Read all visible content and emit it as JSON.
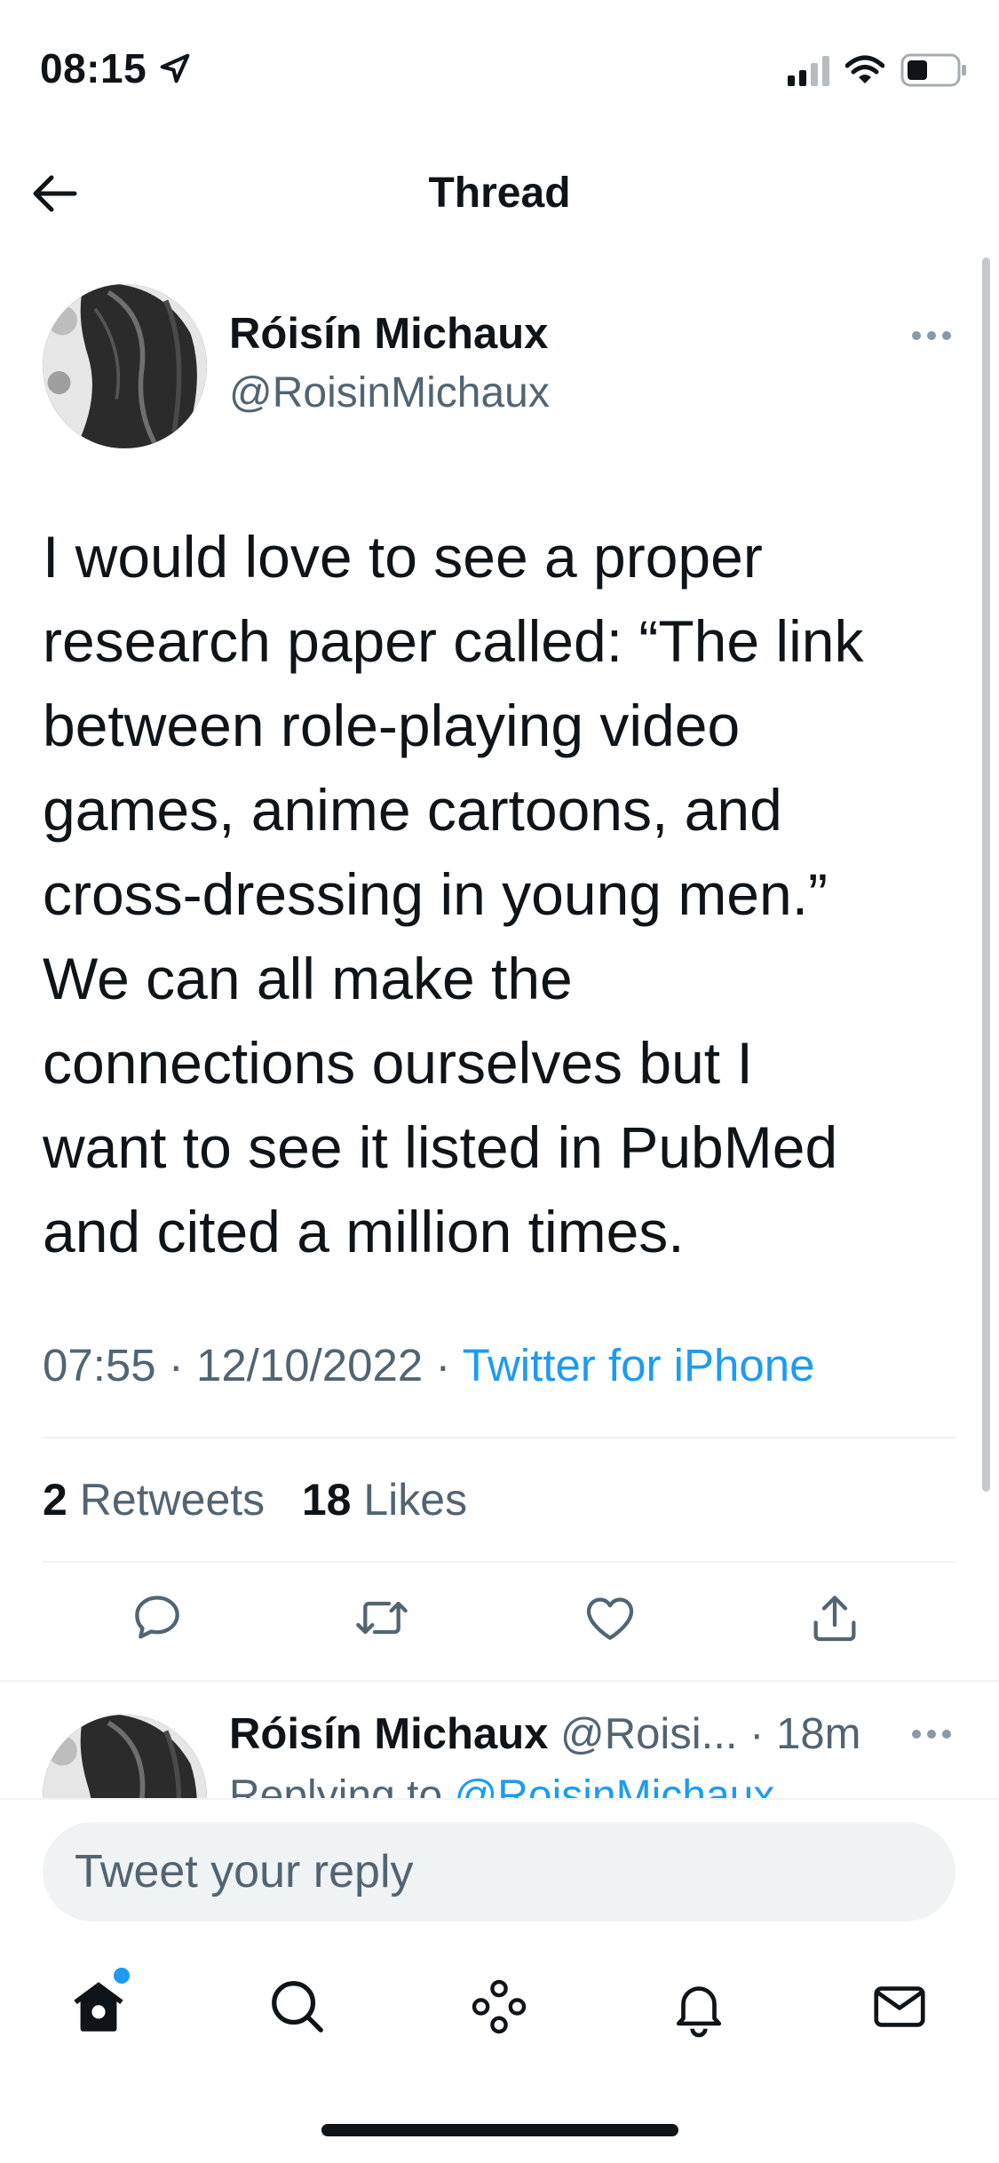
{
  "status_bar": {
    "time": "08:15"
  },
  "header": {
    "title": "Thread"
  },
  "tweet": {
    "author_name": "Róisín Michaux",
    "author_handle": "@RoisinMichaux",
    "text_lines": [
      "I would love to see a proper",
      "research paper called: “The link",
      "between role-playing video",
      "games, anime cartoons, and",
      "cross-dressing in young men.”",
      "We can all make the",
      "connections ourselves but I",
      "want to see it listed in PubMed",
      "and cited a million times."
    ],
    "time": "07:55",
    "date": "12/10/2022",
    "separator": "·",
    "source": "Twitter for iPhone",
    "retweets_count": "2",
    "retweets_label": "Retweets",
    "likes_count": "18",
    "likes_label": "Likes"
  },
  "reply_preview": {
    "author_name": "Róisín Michaux",
    "author_handle": "@Roisi...",
    "time": "· 18m",
    "replying_label": "Replying to",
    "replying_to": "@RoisinMichaux"
  },
  "composer": {
    "placeholder": "Tweet your reply"
  },
  "colors": {
    "accent": "#1d9bf0",
    "secondary_text": "#536471",
    "text": "#0f1419",
    "divider": "#eff3f4"
  },
  "icons": [
    "location-arrow-icon",
    "signal-icon",
    "wifi-icon",
    "battery-icon",
    "back-arrow-icon",
    "more-icon",
    "reply-icon",
    "retweet-icon",
    "like-icon",
    "share-icon",
    "home-icon",
    "search-icon",
    "spaces-icon",
    "notifications-icon",
    "messages-icon"
  ]
}
